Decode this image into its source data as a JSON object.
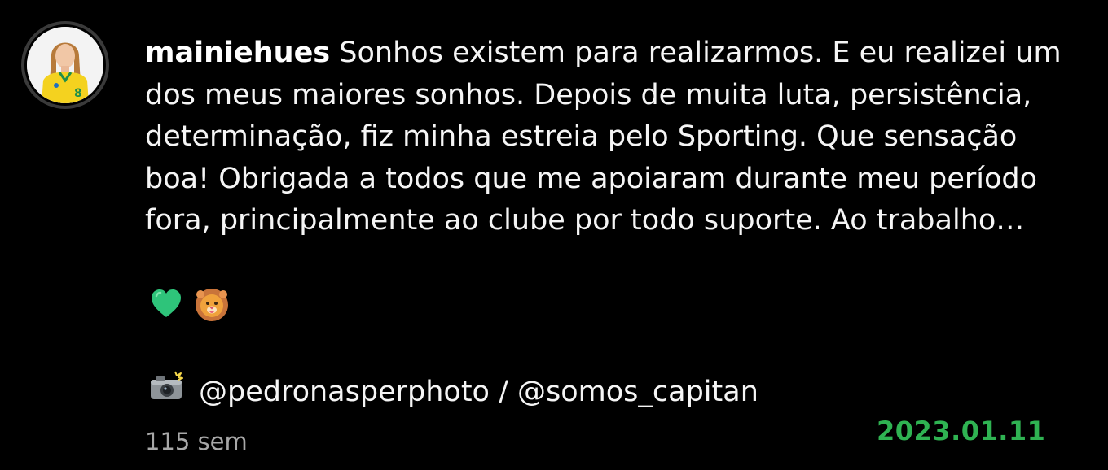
{
  "post": {
    "username": "mainiehues",
    "caption_lines": [
      "Sonhos existem para realizarmos. E eu realizei um",
      "dos meus maiores sonhos. Depois de muita luta, persistência,",
      "determinação, fiz minha estreia pelo Sporting. Que sensação",
      "boa! Obrigada a todos que me apoiaram durante meu período",
      "fora, principalmente ao clube por todo suporte. Ao trabalho…"
    ],
    "emojis": [
      "green-heart-icon",
      "lion-face-icon"
    ],
    "photo_credit": {
      "icon": "camera-flash-icon",
      "text": "@pedronasperphoto / @somos_capitan"
    },
    "time_ago": "115 sem",
    "date_stamp": "2023.01.11"
  },
  "colors": {
    "background": "#000000",
    "text": "#f5f5f5",
    "muted": "#a8a8a8",
    "date_green": "#2fb352",
    "heart_green": "#2ec47a",
    "lion_orange": "#f0a23c"
  }
}
